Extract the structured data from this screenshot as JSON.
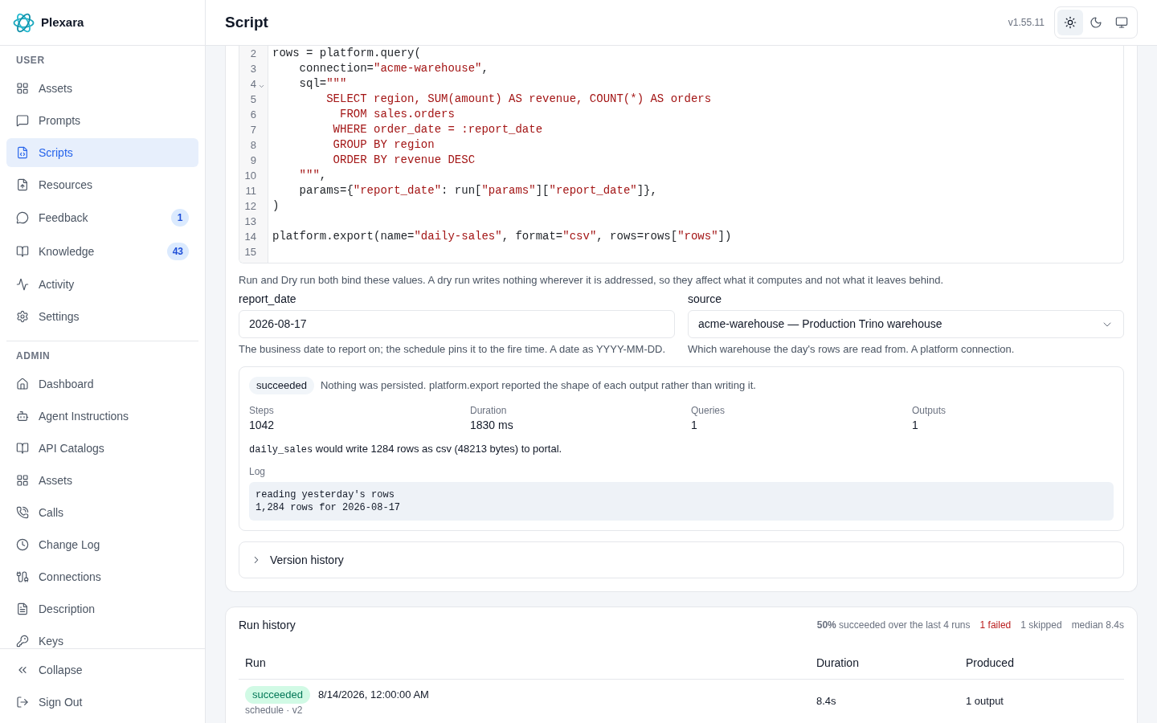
{
  "sidebar": {
    "brand": "Plexara",
    "sections": [
      {
        "title": "USER",
        "items": [
          {
            "label": "Assets",
            "selected": false
          },
          {
            "label": "Prompts",
            "selected": false
          },
          {
            "label": "Scripts",
            "selected": true
          },
          {
            "label": "Resources",
            "selected": false
          },
          {
            "label": "Feedback",
            "selected": false,
            "badge": "1"
          },
          {
            "label": "Knowledge",
            "selected": false,
            "badge": "43"
          },
          {
            "label": "Activity",
            "selected": false
          },
          {
            "label": "Settings",
            "selected": false
          }
        ]
      },
      {
        "title": "ADMIN",
        "items": [
          {
            "label": "Dashboard",
            "selected": false
          },
          {
            "label": "Agent Instructions",
            "selected": false
          },
          {
            "label": "API Catalogs",
            "selected": false
          },
          {
            "label": "Assets",
            "selected": false
          },
          {
            "label": "Calls",
            "selected": false
          },
          {
            "label": "Change Log",
            "selected": false
          },
          {
            "label": "Connections",
            "selected": false
          },
          {
            "label": "Description",
            "selected": false
          },
          {
            "label": "Keys",
            "selected": false
          }
        ]
      }
    ],
    "footer": [
      "Collapse",
      "Sign Out"
    ]
  },
  "header": {
    "title": "Script",
    "version": "v1.55.11",
    "theme_options": [
      {
        "kind": "light",
        "selected": true
      },
      {
        "kind": "dark",
        "selected": false
      },
      {
        "kind": "system",
        "selected": false
      }
    ]
  },
  "editor": {
    "lines": [
      {
        "number": "2",
        "foldable": false,
        "segments": [
          {
            "kind": "code",
            "text": "rows = platform.query("
          }
        ]
      },
      {
        "number": "3",
        "foldable": false,
        "segments": [
          {
            "kind": "code",
            "text": "    connection="
          },
          {
            "kind": "string",
            "text": "\"acme-warehouse\""
          },
          {
            "kind": "code",
            "text": ","
          }
        ]
      },
      {
        "number": "4",
        "foldable": true,
        "segments": [
          {
            "kind": "code",
            "text": "    sql="
          },
          {
            "kind": "string",
            "text": "\"\"\""
          }
        ]
      },
      {
        "number": "5",
        "foldable": false,
        "segments": [
          {
            "kind": "string",
            "text": "        SELECT region, SUM(amount) AS revenue, COUNT(*) AS orders"
          }
        ]
      },
      {
        "number": "6",
        "foldable": false,
        "segments": [
          {
            "kind": "string",
            "text": "          FROM sales.orders"
          }
        ]
      },
      {
        "number": "7",
        "foldable": false,
        "segments": [
          {
            "kind": "string",
            "text": "         WHERE order_date = :report_date"
          }
        ]
      },
      {
        "number": "8",
        "foldable": false,
        "segments": [
          {
            "kind": "string",
            "text": "         GROUP BY region"
          }
        ]
      },
      {
        "number": "9",
        "foldable": false,
        "segments": [
          {
            "kind": "string",
            "text": "         ORDER BY revenue DESC"
          }
        ]
      },
      {
        "number": "10",
        "foldable": false,
        "segments": [
          {
            "kind": "string",
            "text": "    \"\"\""
          },
          {
            "kind": "code",
            "text": ","
          }
        ]
      },
      {
        "number": "11",
        "foldable": false,
        "segments": [
          {
            "kind": "code",
            "text": "    params={"
          },
          {
            "kind": "string",
            "text": "\"report_date\""
          },
          {
            "kind": "code",
            "text": ": run["
          },
          {
            "kind": "string",
            "text": "\"params\""
          },
          {
            "kind": "code",
            "text": "]["
          },
          {
            "kind": "string",
            "text": "\"report_date\""
          },
          {
            "kind": "code",
            "text": "]},"
          }
        ]
      },
      {
        "number": "12",
        "foldable": false,
        "segments": [
          {
            "kind": "code",
            "text": ")"
          }
        ]
      },
      {
        "number": "13",
        "foldable": false
      },
      {
        "number": "14",
        "foldable": false,
        "segments": [
          {
            "kind": "code",
            "text": "platform.export(name="
          },
          {
            "kind": "string",
            "text": "\"daily-sales\""
          },
          {
            "kind": "code",
            "text": ", format="
          },
          {
            "kind": "string",
            "text": "\"csv\""
          },
          {
            "kind": "code",
            "text": ", rows=rows["
          },
          {
            "kind": "string",
            "text": "\"rows\""
          },
          {
            "kind": "code",
            "text": "])"
          }
        ]
      },
      {
        "number": "15",
        "foldable": false
      }
    ]
  },
  "parameters": {
    "description": "Run and Dry run both bind these values. A dry run writes nothing wherever it is addressed, so they affect what it computes and not what it leaves behind.",
    "fields": [
      {
        "kind": "text",
        "label": "report_date",
        "value": "2026-08-17",
        "help": "The business date to report on; the schedule pins it to the fire time. A date as YYYY-MM-DD."
      },
      {
        "kind": "select",
        "label": "source",
        "value": "acme-warehouse — Production Trino warehouse",
        "help": "Which warehouse the day's rows are read from. A platform connection."
      }
    ]
  },
  "dry_run": {
    "status": {
      "label": "succeeded",
      "kind": "neutral"
    },
    "message": "Nothing was persisted. platform.export reported the shape of each output rather than writing it.",
    "stats": [
      {
        "label": "Steps",
        "value": "1042"
      },
      {
        "label": "Duration",
        "value": "1830 ms"
      },
      {
        "label": "Queries",
        "value": "1"
      },
      {
        "label": "Outputs",
        "value": "1"
      }
    ],
    "output": {
      "name": "daily_sales",
      "text": "would write 1284 rows as csv (48213 bytes) to portal."
    },
    "log": {
      "label": "Log",
      "lines": [
        "reading yesterday's rows",
        "1,284 rows for 2026-08-17"
      ]
    }
  },
  "version_history": {
    "label": "Version history",
    "expanded": false
  },
  "run_history": {
    "title": "Run history",
    "summary": [
      {
        "kind": "rate",
        "text": "**50%** succeeded over the last 4 runs"
      },
      {
        "kind": "failed",
        "text": "1 failed"
      },
      {
        "kind": "skipped",
        "text": "1 skipped"
      },
      {
        "kind": "median",
        "text": "median 8.4s"
      }
    ],
    "columns": [
      "Run",
      "Duration",
      "Produced"
    ],
    "rows": [
      {
        "status": {
          "label": "succeeded",
          "kind": "success"
        },
        "time": "8/14/2026, 12:00:00 AM",
        "trigger": "schedule · v2",
        "duration": "8.4s",
        "produced": "1 output"
      }
    ]
  }
}
